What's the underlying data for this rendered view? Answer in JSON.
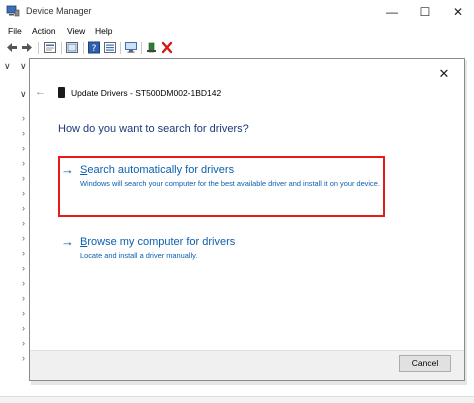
{
  "window": {
    "title": "Device Manager",
    "controls": {
      "minimize": "—",
      "maximize": "☐",
      "close": "✕"
    }
  },
  "menu": [
    {
      "label": "File"
    },
    {
      "label": "Action"
    },
    {
      "label": "View"
    },
    {
      "label": "Help"
    }
  ],
  "tree": {
    "expand_glyph": "∨",
    "collapse_glyph": "›"
  },
  "dialog": {
    "close_glyph": "✕",
    "back_glyph": "←",
    "title": "Update Drivers - ST500DM002-1BD142",
    "heading": "How do you want to search for drivers?",
    "options": [
      {
        "arrow": "→",
        "title_prefix": "S",
        "title_rest": "earch automatically for drivers",
        "description": "Windows will search your computer for the best available driver and install it on your device."
      },
      {
        "arrow": "→",
        "title_prefix": "B",
        "title_rest": "rowse my computer for drivers",
        "description": "Locate and install a driver manually."
      }
    ],
    "cancel_label": "Cancel"
  },
  "colors": {
    "accent": "#0c5fb0",
    "highlight_border": "#e41b1b",
    "heading": "#1a3a7a"
  }
}
